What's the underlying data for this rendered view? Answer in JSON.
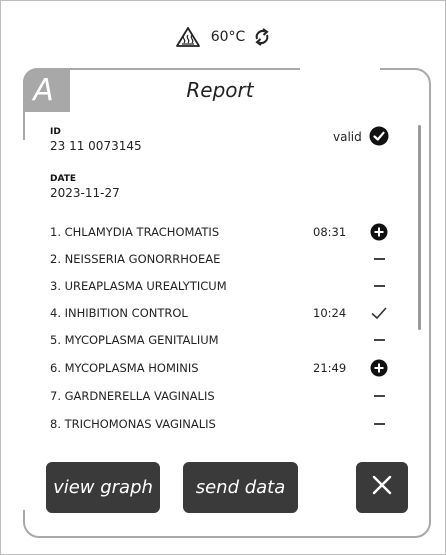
{
  "status": {
    "heater_icon": "heater-warning-icon",
    "temperature": "60°C",
    "sync_icon": "sync-icon"
  },
  "report": {
    "badge": "A",
    "title": "Report",
    "id_label": "ID",
    "id_value": "23 11 0073145",
    "validity": "valid",
    "validity_icon": "check-circle-icon",
    "date_label": "DATE",
    "date_value": "2023-11-27"
  },
  "results": [
    {
      "name": "1. CHLAMYDIA TRACHOMATIS",
      "time": "08:31",
      "indicator": "positive"
    },
    {
      "name": "2. NEISSERIA GONORRHOEAE",
      "time": "",
      "indicator": "negative"
    },
    {
      "name": "3. UREAPLASMA UREALYTICUM",
      "time": "",
      "indicator": "negative"
    },
    {
      "name": "4. INHIBITION CONTROL",
      "time": "10:24",
      "indicator": "check"
    },
    {
      "name": "5. MYCOPLASMA GENITALIUM",
      "time": "",
      "indicator": "negative"
    },
    {
      "name": "6. MYCOPLASMA HOMINIS",
      "time": "21:49",
      "indicator": "positive"
    },
    {
      "name": "7. GARDNERELLA VAGINALIS",
      "time": "",
      "indicator": "negative"
    },
    {
      "name": "8. TRICHOMONAS VAGINALIS",
      "time": "",
      "indicator": "negative"
    }
  ],
  "buttons": {
    "view_graph": "view graph",
    "send_data": "send data",
    "close_icon": "close-icon"
  },
  "colors": {
    "button_bg": "#3a3a3a",
    "badge_bg": "#a8a8a8",
    "border": "#a9a9a9"
  }
}
